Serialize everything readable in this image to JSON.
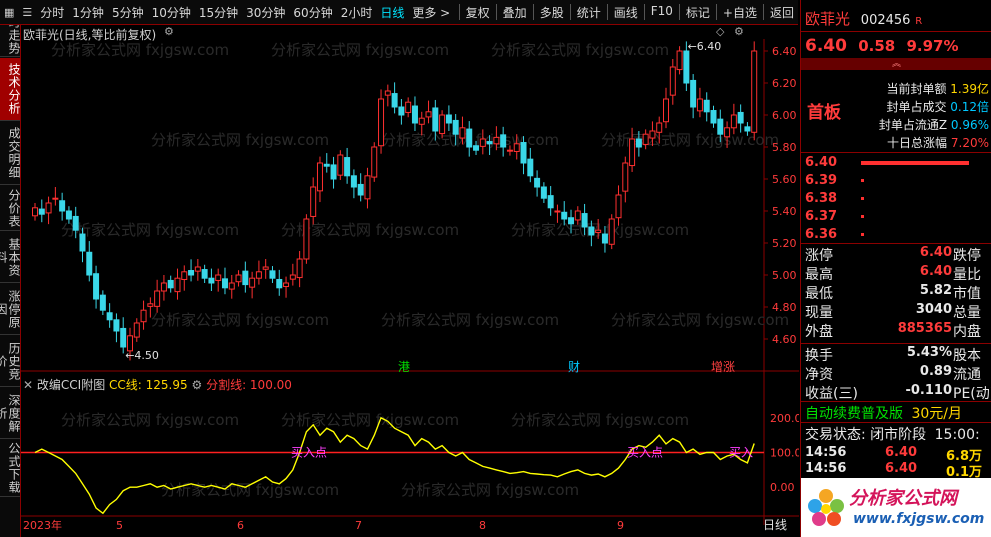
{
  "toolbar": {
    "left": [
      "分时",
      "1分钟",
      "5分钟",
      "10分钟",
      "15分钟",
      "30分钟",
      "60分钟",
      "2小时",
      "日线",
      "更多 >"
    ],
    "active": "日线",
    "right": [
      "复权",
      "叠加",
      "多股",
      "统计",
      "画线",
      "F10",
      "标记",
      "+自选",
      "返回"
    ]
  },
  "sidetabs": [
    "分时走势",
    "技术分析",
    "成交明细",
    "分价表",
    "基本资料",
    "涨停原因",
    "历史竞价",
    "深度解析",
    "公式下载"
  ],
  "sidetab_active": "技术分析",
  "main": {
    "title": "欧菲光(日线,等比前复权)",
    "high_label": "6.40",
    "low_label": "4.50",
    "markers": [
      {
        "text": "港",
        "color": "#00e000"
      },
      {
        "text": "财",
        "color": "#00c8ff"
      },
      {
        "text": "增涨",
        "color": "#ff4040"
      }
    ],
    "y_axis": [
      "6.40",
      "6.20",
      "6.00",
      "5.80",
      "5.60",
      "5.40",
      "5.20",
      "5.00",
      "4.80",
      "4.60"
    ]
  },
  "indicator": {
    "name": "改编CCI附图",
    "cc_label": "CC线: 125.95",
    "split_label": "分割线: 100.00",
    "y_axis": [
      "200.0",
      "100.0",
      "0.00"
    ],
    "buy_labels": [
      "买入点",
      "买入点",
      "买入"
    ]
  },
  "xaxis": {
    "labels": [
      "2023年",
      "5",
      "6",
      "7",
      "8",
      "9"
    ],
    "right": "日线"
  },
  "watermark": "分析家公式网  fxjgsw.com",
  "panel": {
    "name": "欧菲光",
    "code": "002456",
    "tag": "R",
    "price": "6.40",
    "change": "0.58",
    "pct": "9.97%",
    "limit_up": "首板",
    "seal_stats": [
      {
        "label": "当前封单额",
        "value": "1.39亿"
      },
      {
        "label": "封单占成交",
        "value": "0.12倍"
      },
      {
        "label": "封单占流通Z",
        "value": "0.96%"
      },
      {
        "label": "十日总涨幅",
        "value": "7.20%"
      }
    ],
    "book": [
      {
        "price": "6.40"
      },
      {
        "price": "6.39"
      },
      {
        "price": "6.38"
      },
      {
        "price": "6.37"
      },
      {
        "price": "6.36"
      }
    ],
    "quote": [
      {
        "l1": "涨停",
        "v1": "6.40",
        "l2": "跌停"
      },
      {
        "l1": "最高",
        "v1": "6.40",
        "l2": "量比"
      },
      {
        "l1": "最低",
        "v1": "5.82",
        "l2": "市值"
      },
      {
        "l1": "现量",
        "v1": "3040",
        "l2": "总量"
      },
      {
        "l1": "外盘",
        "v1": "885365",
        "l2": "内盘"
      }
    ],
    "stats": [
      {
        "l1": "换手",
        "v1": "5.43%",
        "l2": "股本"
      },
      {
        "l1": "净资",
        "v1": "0.89",
        "l2": "流通"
      },
      {
        "l1": "收益(三)",
        "v1": "-0.110",
        "l2": "PE(动)"
      }
    ],
    "promo": "自动续费普及版",
    "promo_price": "30元/月",
    "status": "交易状态: 闭市阶段",
    "status_time": "15:00:",
    "ticks": [
      {
        "time": "14:56",
        "price": "6.40",
        "vol": "6.8万"
      },
      {
        "time": "14:56",
        "price": "6.40",
        "vol": "0.1万"
      }
    ],
    "logo_text": "分析家公式网",
    "logo_url": "www.fxjgsw.com"
  },
  "chart_data": {
    "type": "candlestick",
    "price_range": [
      4.5,
      6.45
    ],
    "cci_range": [
      -80,
      260
    ],
    "closes": [
      5.42,
      5.38,
      5.45,
      5.48,
      5.4,
      5.35,
      5.28,
      5.15,
      5.0,
      4.85,
      4.78,
      4.72,
      4.65,
      4.55,
      4.62,
      4.7,
      4.78,
      4.82,
      4.9,
      4.95,
      4.92,
      4.98,
      5.02,
      5.0,
      5.05,
      4.98,
      4.95,
      5.0,
      4.92,
      4.95,
      5.0,
      4.94,
      4.98,
      5.02,
      5.05,
      4.98,
      4.92,
      4.95,
      5.0,
      5.1,
      5.35,
      5.55,
      5.7,
      5.68,
      5.6,
      5.75,
      5.62,
      5.55,
      5.5,
      5.62,
      5.8,
      6.1,
      6.15,
      6.05,
      6.0,
      6.08,
      5.95,
      5.98,
      6.02,
      5.9,
      6.0,
      5.95,
      5.88,
      5.92,
      5.8,
      5.78,
      5.85,
      5.82,
      5.86,
      5.8,
      5.78,
      5.82,
      5.7,
      5.62,
      5.55,
      5.48,
      5.42,
      5.4,
      5.35,
      5.32,
      5.4,
      5.3,
      5.25,
      5.28,
      5.2,
      5.35,
      5.5,
      5.7,
      5.85,
      5.8,
      5.88,
      5.9,
      5.95,
      6.1,
      6.3,
      6.4,
      6.2,
      6.05,
      6.1,
      6.02,
      5.95,
      5.88,
      5.92,
      6.0,
      5.95,
      5.9,
      6.4
    ],
    "cci": [
      100,
      110,
      100,
      90,
      80,
      60,
      40,
      10,
      -20,
      -60,
      -75,
      -50,
      -35,
      -10,
      0,
      0,
      5,
      10,
      0,
      5,
      -5,
      0,
      5,
      10,
      5,
      0,
      5,
      0,
      -5,
      10,
      5,
      0,
      10,
      20,
      30,
      15,
      10,
      25,
      50,
      100,
      160,
      180,
      150,
      170,
      160,
      130,
      150,
      140,
      120,
      110,
      150,
      200,
      190,
      170,
      160,
      150,
      120,
      140,
      130,
      110,
      120,
      100,
      90,
      100,
      80,
      70,
      60,
      55,
      50,
      45,
      40,
      42,
      45,
      40,
      38,
      36,
      35,
      30,
      38,
      45,
      50,
      40,
      35,
      38,
      30,
      40,
      55,
      80,
      110,
      120,
      115,
      130,
      150,
      125,
      140,
      130,
      100,
      110,
      95,
      100,
      100,
      80,
      90,
      95,
      80,
      70,
      125.95
    ]
  }
}
